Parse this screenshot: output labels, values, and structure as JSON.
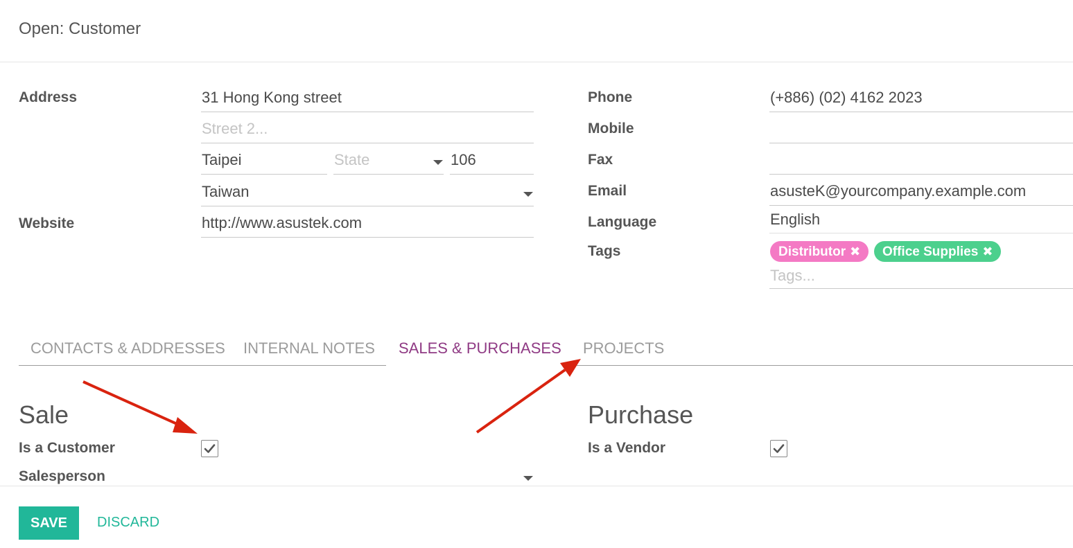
{
  "dialog": {
    "title": "Open: Customer"
  },
  "address": {
    "label": "Address",
    "street": "31 Hong Kong street",
    "street2_placeholder": "Street 2...",
    "city": "Taipei",
    "state_placeholder": "State",
    "zip": "106",
    "country": "Taiwan"
  },
  "website": {
    "label": "Website",
    "value": "http://www.asustek.com"
  },
  "phone": {
    "label": "Phone",
    "value": "(+886) (02) 4162 2023"
  },
  "mobile": {
    "label": "Mobile",
    "value": ""
  },
  "fax": {
    "label": "Fax",
    "value": ""
  },
  "email": {
    "label": "Email",
    "value": "asusteK@yourcompany.example.com"
  },
  "language": {
    "label": "Language",
    "value": "English"
  },
  "tags": {
    "label": "Tags",
    "placeholder": "Tags...",
    "items": [
      {
        "label": "Distributor",
        "color": "#f47ac4"
      },
      {
        "label": "Office Supplies",
        "color": "#4cd08d"
      }
    ]
  },
  "tabs": [
    {
      "label": "CONTACTS & ADDRESSES",
      "active": false
    },
    {
      "label": "INTERNAL NOTES",
      "active": false
    },
    {
      "label": "SALES & PURCHASES",
      "active": true
    },
    {
      "label": "PROJECTS",
      "active": false
    }
  ],
  "sale": {
    "title": "Sale",
    "is_customer_label": "Is a Customer",
    "is_customer": true,
    "salesperson_label": "Salesperson"
  },
  "purchase": {
    "title": "Purchase",
    "is_vendor_label": "Is a Vendor",
    "is_vendor": true
  },
  "footer": {
    "save_label": "SAVE",
    "discard_label": "DISCARD"
  },
  "colors": {
    "accent": "#21b799",
    "active_tab": "#8f3a84",
    "annotation_arrow": "#d9230f"
  }
}
